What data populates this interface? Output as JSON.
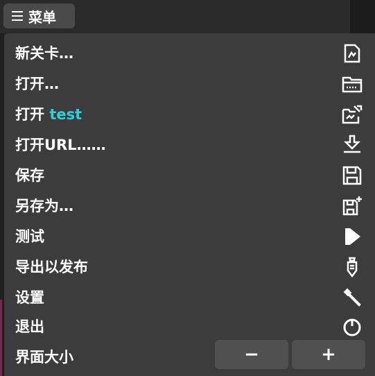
{
  "header": {
    "menu_label": "菜单"
  },
  "menu": {
    "items": [
      {
        "label": "新关卡…",
        "icon": "new-file-icon"
      },
      {
        "label": "打开…",
        "icon": "folder-icon"
      },
      {
        "label_prefix": "打开 ",
        "label_highlight": "test",
        "icon": "open-recent-icon"
      },
      {
        "label": "打开URL……",
        "icon": "download-icon"
      },
      {
        "label": "保存",
        "icon": "save-icon"
      },
      {
        "label": "另存为…",
        "icon": "save-as-icon"
      },
      {
        "label": "测试",
        "icon": "play-icon"
      },
      {
        "label": "导出以发布",
        "icon": "export-icon"
      },
      {
        "label": "设置",
        "icon": "wrench-icon"
      },
      {
        "label": "退出",
        "icon": "power-icon"
      }
    ],
    "ui_scale": {
      "label": "界面大小",
      "decrease": "−",
      "increase": "+"
    }
  },
  "colors": {
    "highlight": "#2fd0de",
    "panel": "#3c3c3c",
    "button": "#505050"
  }
}
